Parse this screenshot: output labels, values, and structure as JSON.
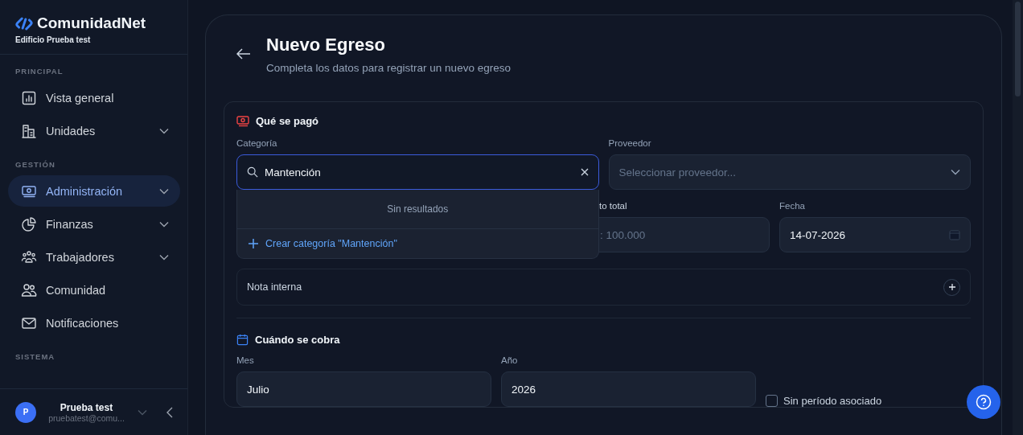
{
  "sidebar": {
    "brand": "ComunidadNet",
    "building": "Edificio Prueba test",
    "sections": [
      {
        "label": "PRINCIPAL",
        "items": [
          {
            "label": "Vista general",
            "kind": "chart",
            "expandable": false,
            "selected": false
          },
          {
            "label": "Unidades",
            "kind": "building",
            "expandable": true,
            "selected": false
          }
        ]
      },
      {
        "label": "GESTIÓN",
        "items": [
          {
            "label": "Administración",
            "kind": "money",
            "expandable": true,
            "selected": true
          },
          {
            "label": "Finanzas",
            "kind": "pie",
            "expandable": true,
            "selected": false
          },
          {
            "label": "Trabajadores",
            "kind": "team",
            "expandable": true,
            "selected": false
          },
          {
            "label": "Comunidad",
            "kind": "users",
            "expandable": false,
            "selected": false
          },
          {
            "label": "Notificaciones",
            "kind": "mail",
            "expandable": false,
            "selected": false
          }
        ]
      },
      {
        "label": "SISTEMA"
      }
    ],
    "user": {
      "initial": "P",
      "name": "Prueba test",
      "email": "pruebatest@comu..."
    }
  },
  "page": {
    "title": "Nuevo Egreso",
    "subtitle": "Completa los datos para registrar un nuevo egreso"
  },
  "paid": {
    "title": "Qué se pagó",
    "category": {
      "label": "Categoría",
      "value": "Mantención",
      "no_results": "Sin resultados",
      "create": "Crear categoría \"Mantención\""
    },
    "supplier": {
      "label": "Proveedor",
      "placeholder": "Seleccionar proveedor..."
    },
    "amount": {
      "label": "to total",
      "placeholder": ": 100.000"
    },
    "date": {
      "label": "Fecha",
      "value": "14-07-2026"
    },
    "note": {
      "label": "Nota interna"
    }
  },
  "when": {
    "title": "Cuándo se cobra",
    "month": {
      "label": "Mes",
      "value": "Julio"
    },
    "year": {
      "label": "Año",
      "value": "2026"
    },
    "no_period": {
      "label": "Sin período asociado",
      "checked": false
    }
  }
}
